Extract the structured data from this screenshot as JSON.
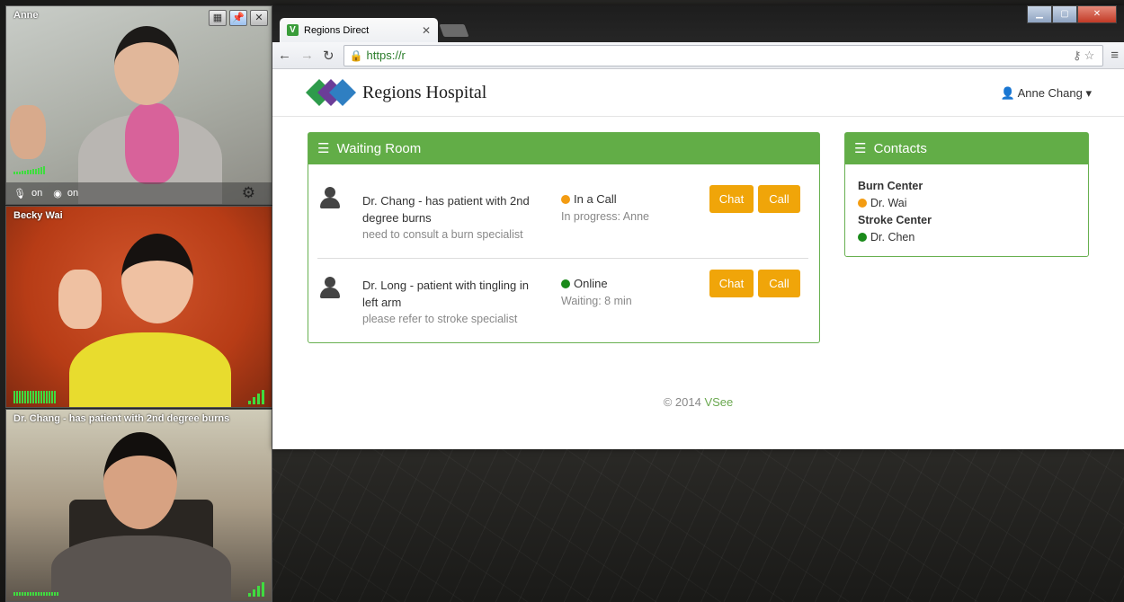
{
  "videos": [
    {
      "name": "Anne",
      "mic_label": "on",
      "cam_label": "on"
    },
    {
      "name": "Becky Wai"
    },
    {
      "name": "Dr. Chang - has patient with 2nd degree burns"
    }
  ],
  "browser": {
    "tab_title": "Regions Direct",
    "favicon_letter": "V",
    "url": "https://r"
  },
  "site": {
    "brand": "Regions Hospital",
    "user": "Anne Chang"
  },
  "waiting_room": {
    "title": "Waiting Room",
    "entries": [
      {
        "title": "Dr. Chang - has patient with 2nd degree burns",
        "note": "need to consult a burn specialist",
        "status": "In a Call",
        "status_color": "#f39c12",
        "sub": "In progress: Anne",
        "chat_label": "Chat",
        "call_label": "Call"
      },
      {
        "title": "Dr. Long - patient with tingling in left arm",
        "note": "please refer to stroke specialist",
        "status": "Online",
        "status_color": "#1a8a1a",
        "sub": "Waiting: 8 min",
        "chat_label": "Chat",
        "call_label": "Call"
      }
    ]
  },
  "contacts": {
    "title": "Contacts",
    "groups": [
      {
        "name": "Burn Center",
        "contact": "Dr. Wai",
        "status_color": "#f39c12"
      },
      {
        "name": "Stroke Center",
        "contact": "Dr. Chen",
        "status_color": "#1a8a1a"
      }
    ]
  },
  "footer": {
    "copyright": "© 2014",
    "link": "VSee"
  },
  "colors": {
    "accent_green": "#62ad47",
    "button_orange": "#f0a509"
  }
}
